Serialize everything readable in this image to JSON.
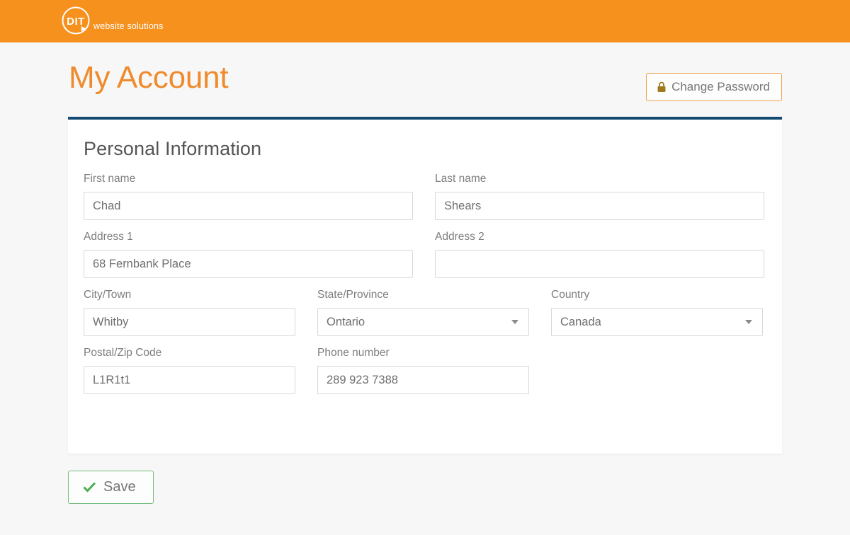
{
  "brand": {
    "logo_mark_text": "DIT",
    "logo_tagline": "website solutions",
    "header_color": "#f6911e",
    "accent_color": "#ef8b2c",
    "card_top_border_color": "#134a72"
  },
  "page": {
    "title": "My Account"
  },
  "actions": {
    "change_password_label": "Change Password",
    "change_password_icon": "lock-icon",
    "save_label": "Save",
    "save_icon": "check-icon",
    "save_border_color": "#76bd7e",
    "lock_icon_color": "#a07b1e"
  },
  "card": {
    "section_title": "Personal Information",
    "fields": {
      "first_name": {
        "label": "First name",
        "value": "Chad",
        "placeholder": ""
      },
      "last_name": {
        "label": "Last name",
        "value": "Shears",
        "placeholder": ""
      },
      "address_1": {
        "label": "Address 1",
        "value": "68 Fernbank Place",
        "placeholder": ""
      },
      "address_2": {
        "label": "Address 2",
        "value": "",
        "placeholder": ""
      },
      "city": {
        "label": "City/Town",
        "value": "Whitby",
        "placeholder": ""
      },
      "state": {
        "label": "State/Province",
        "value": "Ontario",
        "placeholder": ""
      },
      "country": {
        "label": "Country",
        "value": "Canada",
        "placeholder": ""
      },
      "postal": {
        "label": "Postal/Zip Code",
        "value": "L1R1t1",
        "placeholder": ""
      },
      "phone": {
        "label": "Phone number",
        "value": "289 923 7388",
        "placeholder": ""
      }
    }
  }
}
